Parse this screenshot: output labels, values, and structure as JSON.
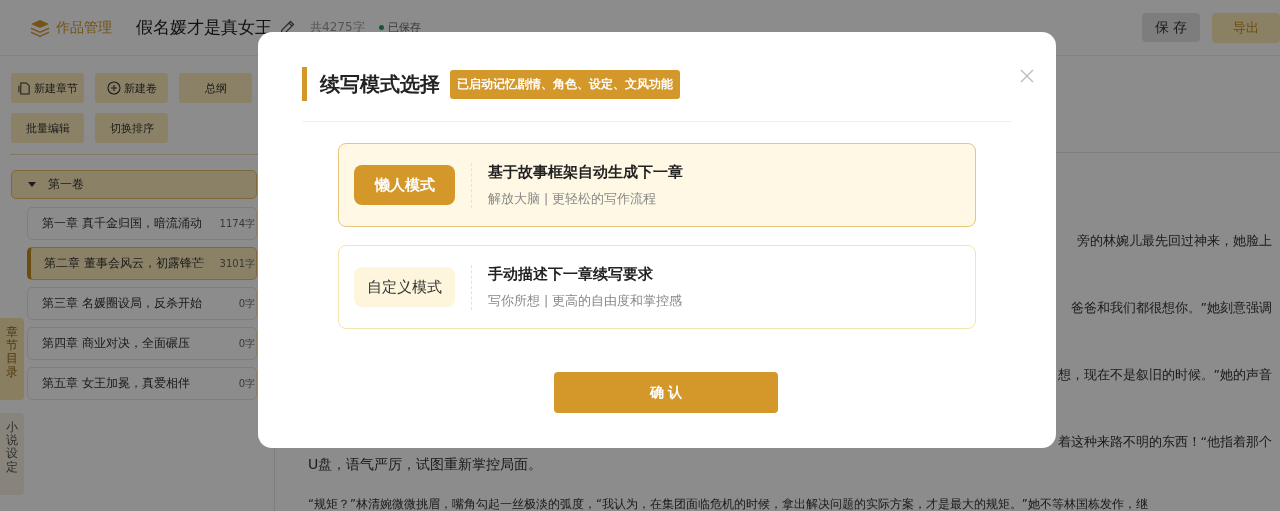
{
  "header": {
    "brand": "作品管理",
    "title": "假名媛才是真女王",
    "word_count": "共4275字",
    "save_status": "已保存",
    "buttons": [
      {
        "label": "保 存",
        "kind": "secondary"
      },
      {
        "label": "导出",
        "kind": "primary"
      }
    ]
  },
  "sidebar": {
    "toolbar": [
      {
        "label": "新建章节",
        "kind": "new-chapter"
      },
      {
        "label": "新建卷",
        "kind": "new-volume"
      },
      {
        "label": "总纲",
        "kind": "plain"
      },
      {
        "label": "批量编辑",
        "kind": "plain"
      },
      {
        "label": "切换排序",
        "kind": "plain"
      }
    ],
    "volumes": [
      {
        "title": "第一卷",
        "expanded": true,
        "chapters": [
          {
            "title": "第一章 真千金归国，暗流涌动",
            "words": "1174字",
            "selected": false
          },
          {
            "title": "第二章 董事会风云，初露锋芒",
            "words": "3101字",
            "selected": true
          },
          {
            "title": "第三章 名媛圈设局，反杀开始",
            "words": "0字",
            "selected": false
          },
          {
            "title": "第四章 商业对决，全面碾压",
            "words": "0字",
            "selected": false
          },
          {
            "title": "第五章 女王加冕，真爱相伴",
            "words": "0字",
            "selected": false
          }
        ]
      }
    ],
    "side_tabs": [
      {
        "label": "章节目录",
        "selected": true
      },
      {
        "label": "小说设定",
        "selected": false
      }
    ]
  },
  "editor": {
    "paragraphs": [
      {
        "lines": [
          {
            "text": "旁的林婉儿最先回过神来，她脸上",
            "kind": "tail"
          }
        ]
      },
      {
        "lines": [
          {
            "text": "爸爸和我们都很想你。”她刻意强调",
            "kind": "tail"
          }
        ]
      },
      {
        "lines": [
          {
            "text": "想，现在不是叙旧的时候。”她的声音",
            "kind": "tail"
          }
        ]
      },
      {
        "lines": [
          {
            "text": "着这种来路不明的东西！“他指着那个",
            "kind": "tail"
          },
          {
            "text": "U盘，语气严厉，试图重新掌控局面。",
            "kind": "full"
          }
        ]
      },
      {
        "lines": [
          {
            "text": "“规矩？”林清婉微微挑眉，嘴角勾起一丝极淡的弧度，“我认为，在集团面临危机的时候，拿出解决问题的实际方案，才是最大的规矩。”她不等林国栋发作，继",
            "kind": "full"
          }
        ]
      }
    ]
  },
  "dialog": {
    "title": "续写模式选择",
    "badge": "已启动记忆剧情、角色、设定、文风功能",
    "modes": [
      {
        "button": "懒人模式",
        "title": "基于故事框架自动生成下一章",
        "subtitle": "解放大脑 | 更轻松的写作流程",
        "selected": true
      },
      {
        "button": "自定义模式",
        "title": "手动描述下一章续写要求",
        "subtitle": "写你所想 | 更高的自由度和掌控感",
        "selected": false
      }
    ],
    "confirm": "确 认"
  }
}
